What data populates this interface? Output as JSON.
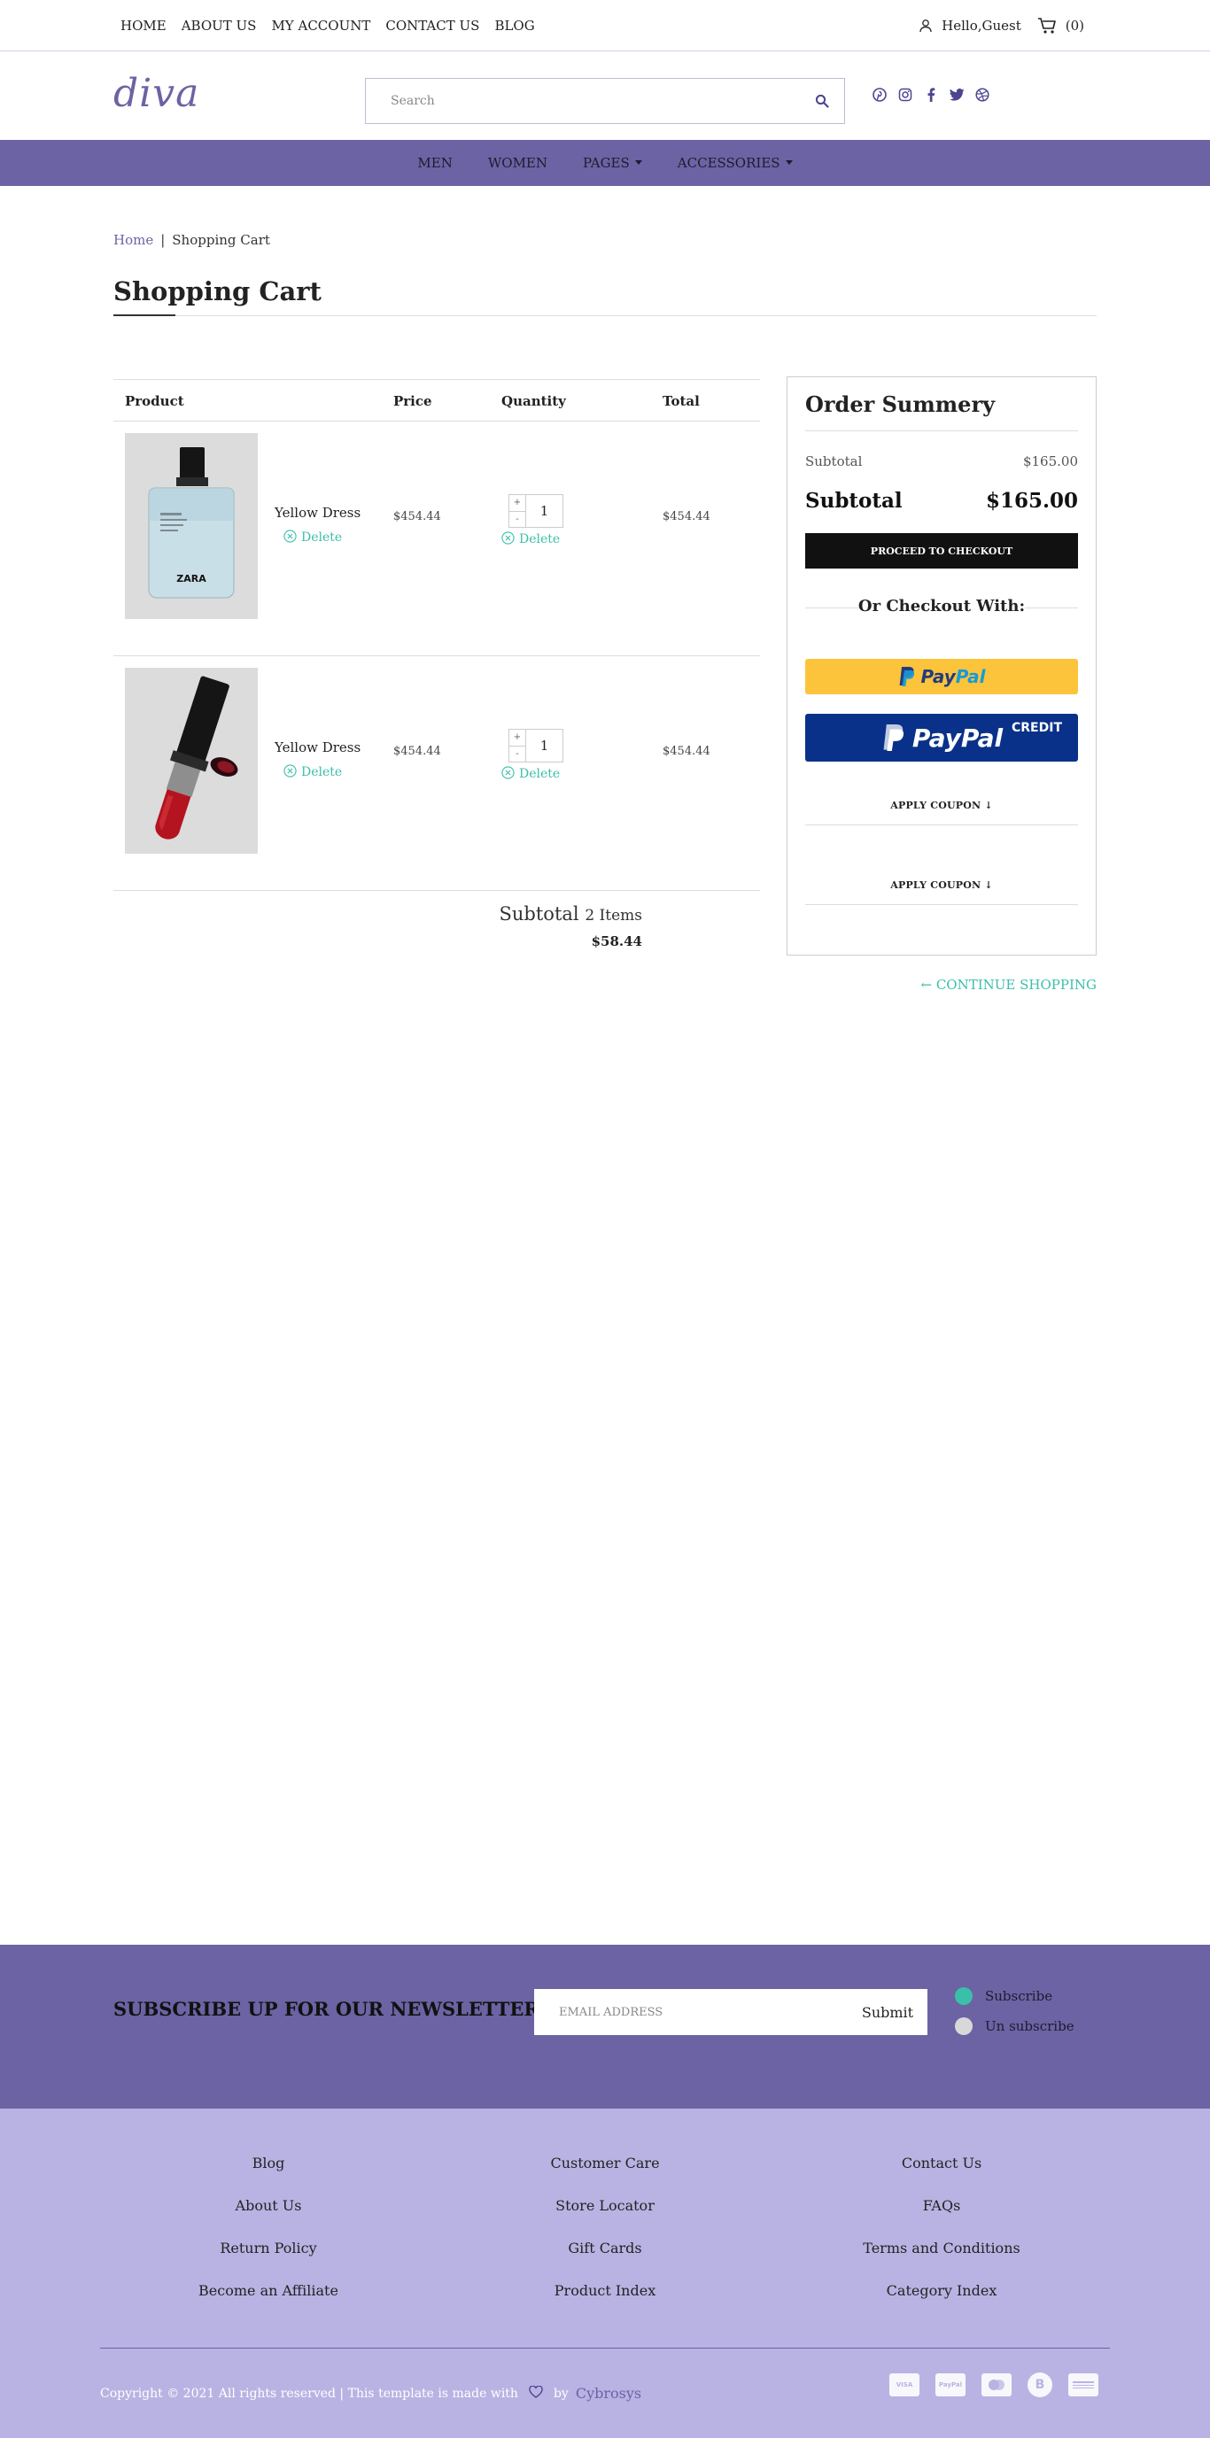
{
  "topbar": {
    "nav": [
      "HOME",
      "ABOUT US",
      "MY ACCOUNT",
      "CONTACT US",
      "BLOG"
    ],
    "greeting": "Hello,Guest",
    "cart_count": "(0)"
  },
  "header": {
    "logo": "diva",
    "search_placeholder": "Search",
    "social_icons": [
      "pinterest-icon",
      "instagram-icon",
      "facebook-icon",
      "twitter-icon",
      "dribbble-icon"
    ]
  },
  "mainnav": [
    "MEN",
    "WOMEN",
    "PAGES",
    "ACCESSORIES"
  ],
  "breadcrumb": {
    "home": "Home",
    "separator": "|",
    "current": "Shopping Cart"
  },
  "page_title": "Shopping Cart",
  "cart": {
    "headers": [
      "Product",
      "Price",
      "Quantity",
      "Total"
    ],
    "items": [
      {
        "name": "Yellow Dress",
        "price": "$454.44",
        "quantity": "1",
        "total": "$454.44",
        "delete": "Delete",
        "image": "perfume-bottle"
      },
      {
        "name": "Yellow Dress",
        "price": "$454.44",
        "quantity": "1",
        "total": "$454.44",
        "delete": "Delete",
        "image": "lipstick"
      }
    ],
    "subtotal_label": "Subtotal",
    "subtotal_count": "2 Items",
    "subtotal_value": "$58.44",
    "plus": "+",
    "minus": "-"
  },
  "summary": {
    "title": "Order Summery",
    "subtotal_small_label": "Subtotal",
    "subtotal_small_value": "$165.00",
    "subtotal_big_label": "Subtotal",
    "subtotal_big_value": "$165.00",
    "checkout": "PROCEED TO CHECKOUT",
    "or_checkout": "Or Checkout With:",
    "paypal": "PayPal",
    "paypal_credit": "CREDIT",
    "coupon": "APPLY COUPON"
  },
  "continue_shopping": "CONTINUE SHOPPING",
  "newsletter": {
    "title": "SUBSCRIBE UP FOR OUR NEWSLETTER",
    "email_placeholder": "EMAIL ADDRESS",
    "submit": "Submit",
    "subscribe": "Subscribe",
    "unsubscribe": "Un subscribe",
    "subscribe_color": "#3bbfa8",
    "unsubscribe_color": "#d8d8d8"
  },
  "footer": {
    "col1": [
      "Blog",
      "About Us",
      "Return Policy",
      "Become an Affiliate"
    ],
    "col2": [
      "Customer Care",
      "Store Locator",
      "Gift Cards",
      "Product Index"
    ],
    "col3": [
      "Contact Us",
      "FAQs",
      "Terms and Conditions",
      "Category Index"
    ],
    "copyright": "Copyright © 2021 All rights reserved | This template is made with",
    "by": "by",
    "brand": "Cybrosys",
    "payment_icons": [
      "visa-icon",
      "paypal-icon",
      "mastercard-icon",
      "bitcoin-icon",
      "amex-icon"
    ],
    "payment_labels": [
      "VISA",
      "PayPal",
      "",
      "B",
      ""
    ]
  },
  "colors": {
    "brand_purple": "#6b63a3",
    "footer_lavender": "#b9b3e3",
    "accent_teal": "#3bbfa8",
    "paypal_gold": "#fcc43a",
    "paypal_blue": "#0a3189"
  }
}
